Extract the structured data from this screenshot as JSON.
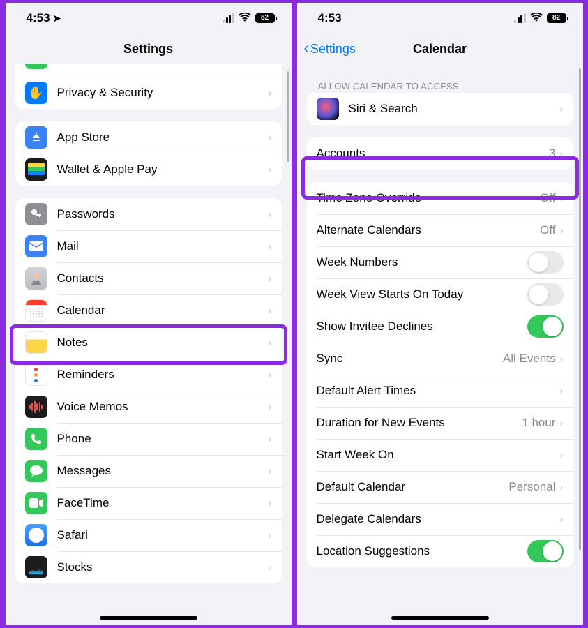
{
  "status": {
    "time": "4:53",
    "battery": "82"
  },
  "left": {
    "title": "Settings",
    "rows": {
      "peek_partial": "",
      "privacy": "Privacy & Security",
      "appstore": "App Store",
      "wallet": "Wallet & Apple Pay",
      "passwords": "Passwords",
      "mail": "Mail",
      "contacts": "Contacts",
      "calendar": "Calendar",
      "notes": "Notes",
      "reminders": "Reminders",
      "voicememos": "Voice Memos",
      "phone": "Phone",
      "messages": "Messages",
      "facetime": "FaceTime",
      "safari": "Safari",
      "stocks": "Stocks"
    }
  },
  "right": {
    "back": "Settings",
    "title": "Calendar",
    "section_access": "ALLOW CALENDAR TO ACCESS",
    "rows": {
      "siri": "Siri & Search",
      "accounts": "Accounts",
      "accounts_val": "3",
      "tz": "Time Zone Override",
      "tz_val": "Off",
      "altcal": "Alternate Calendars",
      "altcal_val": "Off",
      "weeknum": "Week Numbers",
      "weekview": "Week View Starts On Today",
      "invitee": "Show Invitee Declines",
      "sync": "Sync",
      "sync_val": "All Events",
      "alert": "Default Alert Times",
      "duration": "Duration for New Events",
      "duration_val": "1 hour",
      "startweek": "Start Week On",
      "defcal": "Default Calendar",
      "defcal_val": "Personal",
      "delegate": "Delegate Calendars",
      "location": "Location Suggestions"
    }
  }
}
